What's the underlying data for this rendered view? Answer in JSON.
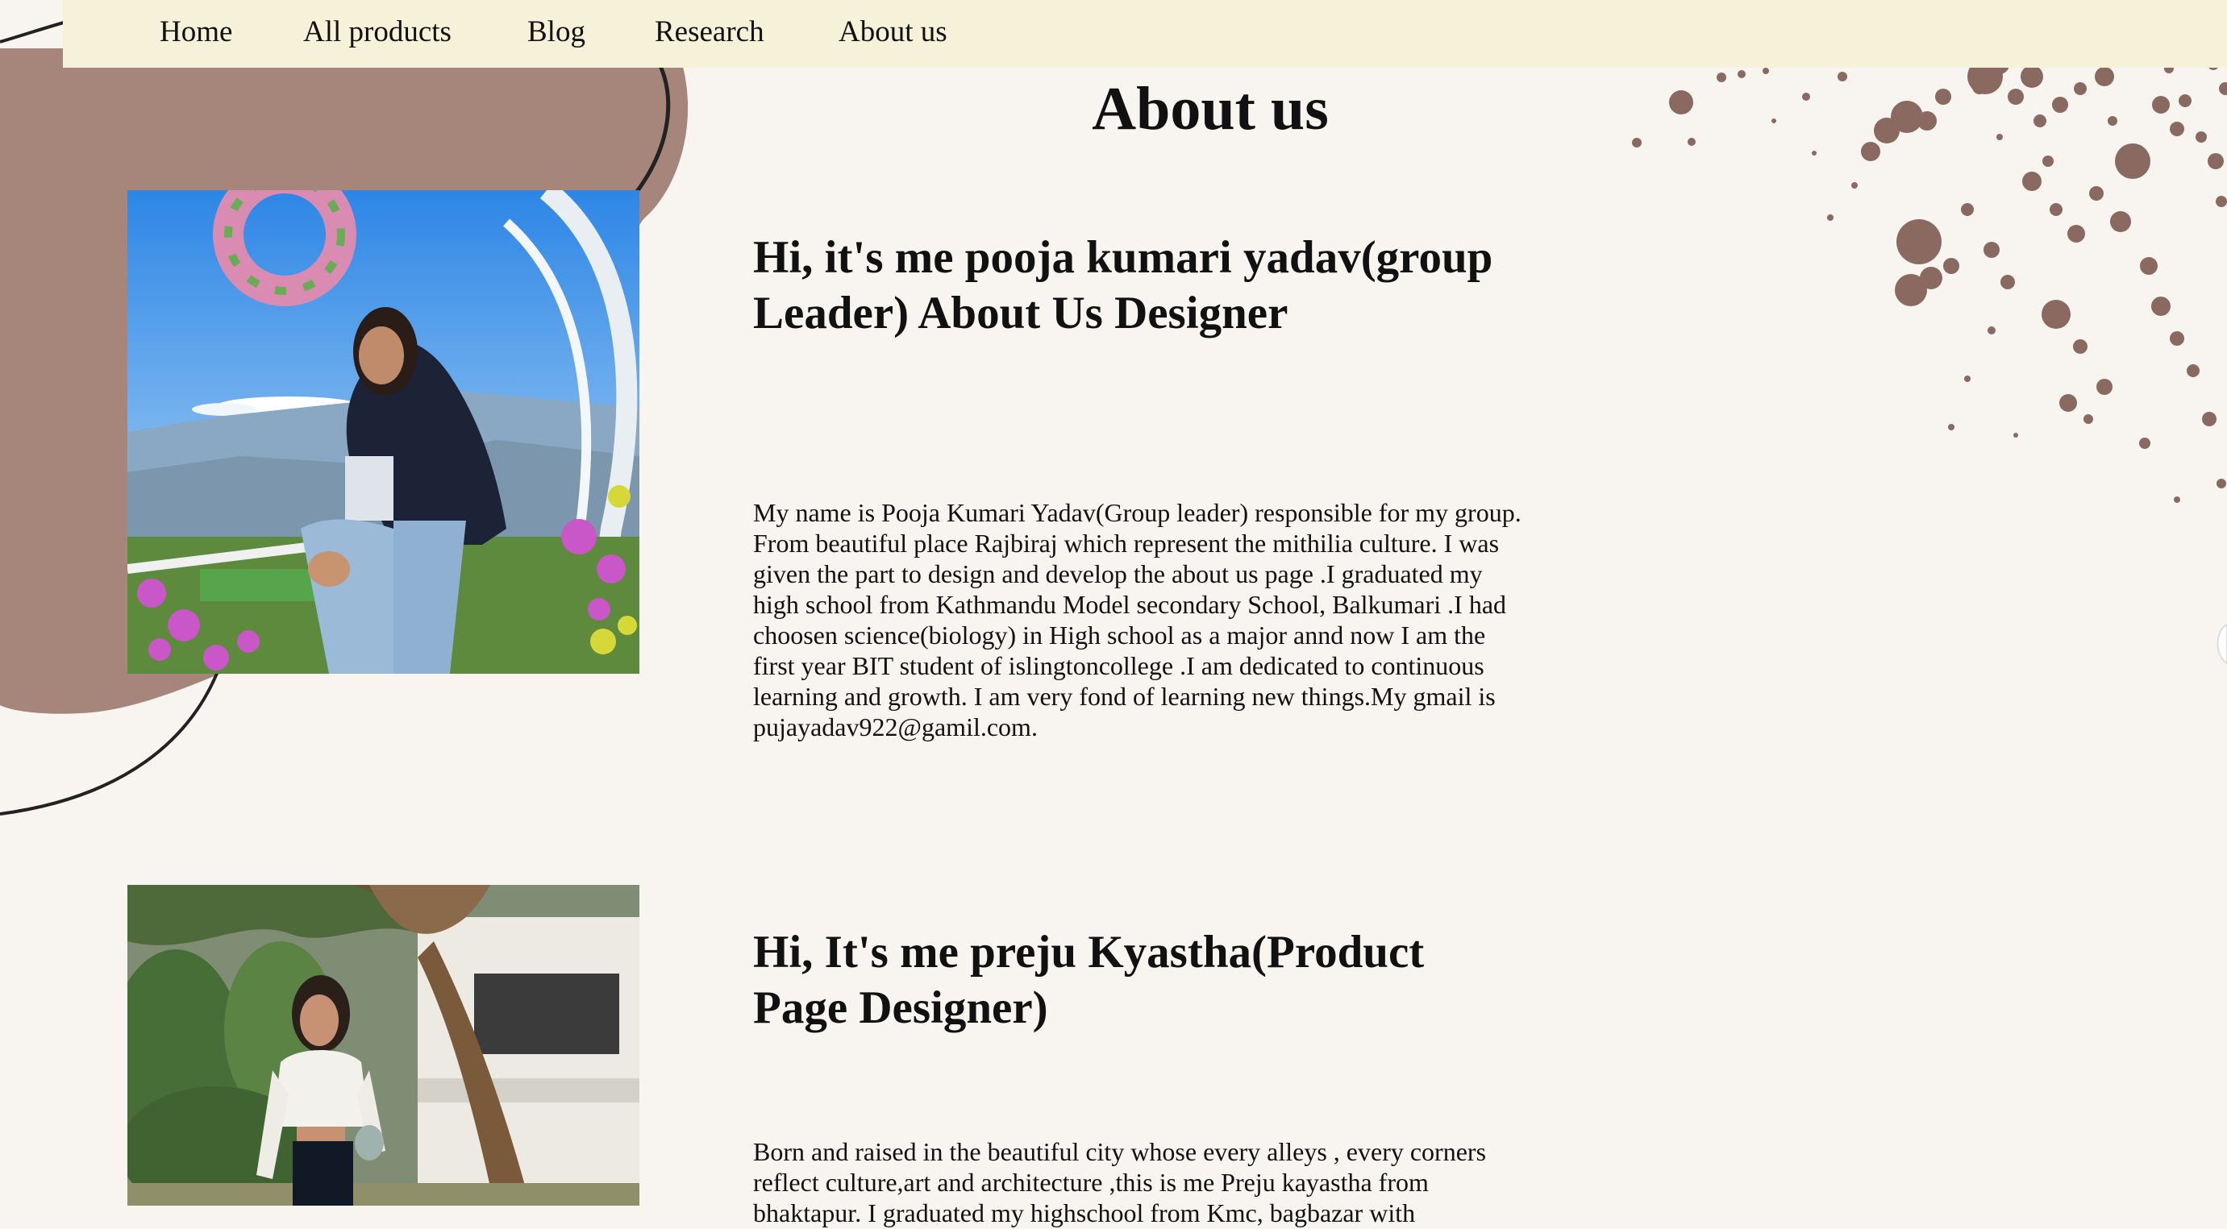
{
  "nav": {
    "items": [
      {
        "label": "Home"
      },
      {
        "label": "All products"
      },
      {
        "label": "Blog"
      },
      {
        "label": "Research"
      },
      {
        "label": "About us"
      }
    ]
  },
  "page_title": "About us",
  "members": [
    {
      "heading": "Hi, it's me pooja kumari yadav(group Leader) About Us Designer",
      "bio": "My name is Pooja Kumari Yadav(Group leader) responsible for my group. From beautiful place Rajbiraj which represent the mithilia culture. I was given the part to design and develop the about us page .I graduated my high school from Kathmandu Model secondary School, Balkumari .I had choosen science(biology) in High school as a major annd now I am the first year BIT student of islingtoncollege .I am dedicated to continuous learning and growth. I am very fond of learning new things.My gmail is pujayadav922@gamil.com."
    },
    {
      "heading": "Hi, It's me preju Kyastha(Product Page Designer)",
      "bio": "Born and raised in the beautiful city whose every alleys , every corners reflect culture,art and architecture ,this is me Preju kayastha from bhaktapur. I graduated my highschool from Kmc, bagbazar with"
    }
  ],
  "colors": {
    "background": "#f8f5f1",
    "navbar": "#f5f2d9",
    "blob": "#a6857a",
    "splatter": "#8a6a60",
    "text": "#111111"
  }
}
